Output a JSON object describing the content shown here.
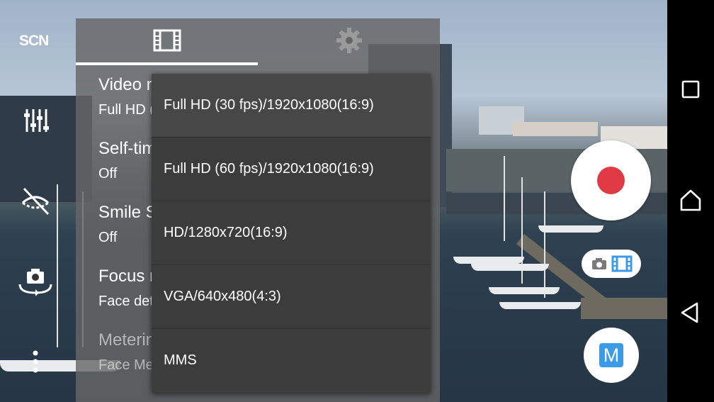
{
  "side_controls": {
    "scene_label": "SCN",
    "icons": [
      "manual-adjust-icon",
      "flash-off-icon",
      "switch-camera-icon",
      "more-options-icon"
    ]
  },
  "settings_panel": {
    "tabs": [
      {
        "name": "video-settings",
        "icon": "film-icon",
        "selected": true
      },
      {
        "name": "general-settings",
        "icon": "gear-icon",
        "selected": false
      }
    ],
    "items": [
      {
        "title": "Video resolution",
        "value": "Full HD (30 fps)/1920x1080(16:9)"
      },
      {
        "title": "Self-timer",
        "value": "Off"
      },
      {
        "title": "Smile Shutter (video)",
        "value": "Off"
      },
      {
        "title": "Focus mode",
        "value": "Face detection"
      },
      {
        "title": "Metering",
        "value": "Face Metering"
      }
    ]
  },
  "resolution_popup": {
    "selected_index": 0,
    "options": [
      "Full HD (30 fps)/1920x1080(16:9)",
      "Full HD (60 fps)/1920x1080(16:9)",
      "HD/1280x720(16:9)",
      "VGA/640x480(4:3)",
      "MMS"
    ]
  },
  "capture": {
    "record_color": "#e03a45",
    "mode_icons": [
      "camera-icon",
      "video-icon"
    ],
    "mode_active_color": "#3b9be6",
    "manual_mode_label": "M"
  },
  "navbar": {
    "buttons": [
      "recent-apps-icon",
      "home-icon",
      "back-icon"
    ]
  }
}
